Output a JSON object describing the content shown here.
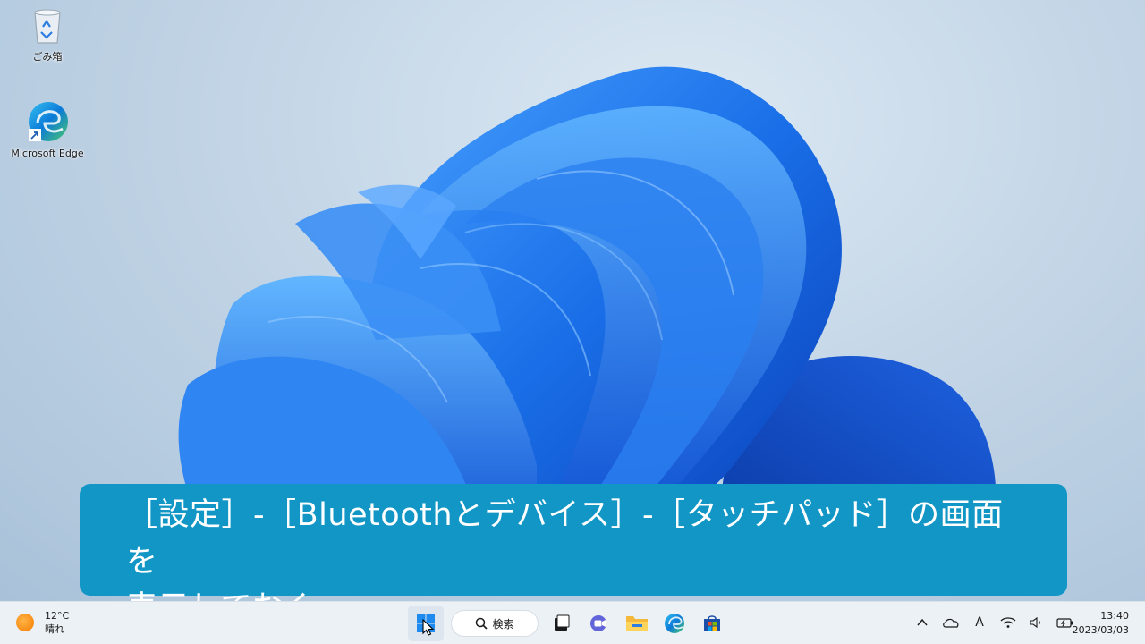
{
  "desktop": {
    "icons": [
      {
        "label": "ごみ箱",
        "icon": "recycle-bin-icon"
      },
      {
        "label": "Microsoft Edge",
        "icon": "edge-icon"
      }
    ]
  },
  "caption": {
    "text": "［設定］-［Bluetoothとデバイス］-［タッチパッド］の画面を\n表示しておく"
  },
  "taskbar": {
    "weather": {
      "temperature": "12°C",
      "condition": "晴れ",
      "icon": "sun-icon"
    },
    "search_label": "検索",
    "apps": [
      {
        "icon": "windows-start-icon"
      },
      {
        "icon": "search-icon"
      },
      {
        "icon": "task-view-icon"
      },
      {
        "icon": "teams-chat-icon"
      },
      {
        "icon": "file-explorer-icon"
      },
      {
        "icon": "edge-icon"
      },
      {
        "icon": "microsoft-store-icon"
      }
    ],
    "tray": {
      "chevron": "^",
      "ime": "A",
      "icons": [
        "chevron-up-icon",
        "onedrive-icon",
        "ime-icon",
        "wifi-icon",
        "volume-icon",
        "battery-icon"
      ]
    },
    "clock": {
      "time": "13:40",
      "date": "2023/03/03"
    }
  },
  "colors": {
    "caption_bg": "#1196c6",
    "taskbar_bg": "#ecf1f6",
    "bloom_blue": "#1a6fe8"
  }
}
